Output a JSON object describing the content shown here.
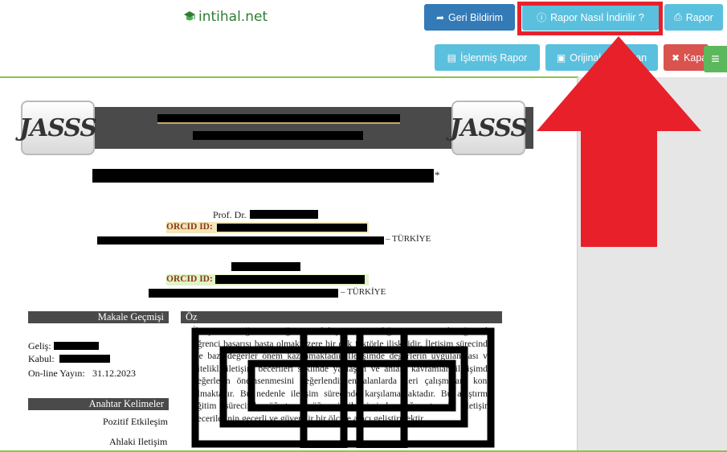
{
  "brand": {
    "name": "intihal.net"
  },
  "toolbar": {
    "geri_bildirim": "Geri Bildirim",
    "rapor_nasil": "Rapor Nasıl İndirilir ?",
    "rapor": "Rapor",
    "islenmis_rapor": "İşlenmiş Rapor",
    "orijinal_dokuman": "Orijinal Doküman",
    "kapat": "Kapat"
  },
  "document": {
    "journal_logo": "JASSS",
    "author_title": "Prof. Dr.",
    "orcid_label": "ORCID ID:",
    "country": "– TÜRKİYE",
    "article_history": {
      "heading": "Makale Geçmişi",
      "received_label": "Geliş:",
      "accepted_label": "Kabul:",
      "online_label": "On-line Yayın:",
      "online_date": "31.12.2023"
    },
    "keywords": {
      "heading": "Anahtar Kelimeler",
      "items": [
        "Pozitif Etkileşim",
        "Ahlaki Iletişim"
      ]
    },
    "abstract_heading": "Öz",
    "abstract_text": "İletişim ve öğretmen öğrenci etkileşiminin niteliği aynı zamanda eğitimde öğrenci başarısı başta olmak üzere bir çok faktörle ilişkilidir. İletişim sürecinde ise bazı değerler önem kazanmaktadır. İletişimde değerlerin uygulanması ve nitelikli iletişim becerileri seklinde yaklaşım ve ahlaki kavramlar, iletişimde değerlerin önemsenmesini değerlendirilen alanlarda ileri çalışmalara konu olmaktadır. Bu nedenle iletişim sürecinde karşılamamaktadır. Bu araştırma eğitim sürecinde öğretmen öğrenci iletişiminde değer temelli iletişim becerilerinin geçerli ve güvenilir bir ölçme aracı geliştirmektir."
  },
  "colors": {
    "accent_green": "#8bc34a",
    "highlight_red": "#e8202a",
    "btn_blue": "#337ab7",
    "btn_cyan": "#5bc0de",
    "btn_red": "#d9534f"
  }
}
